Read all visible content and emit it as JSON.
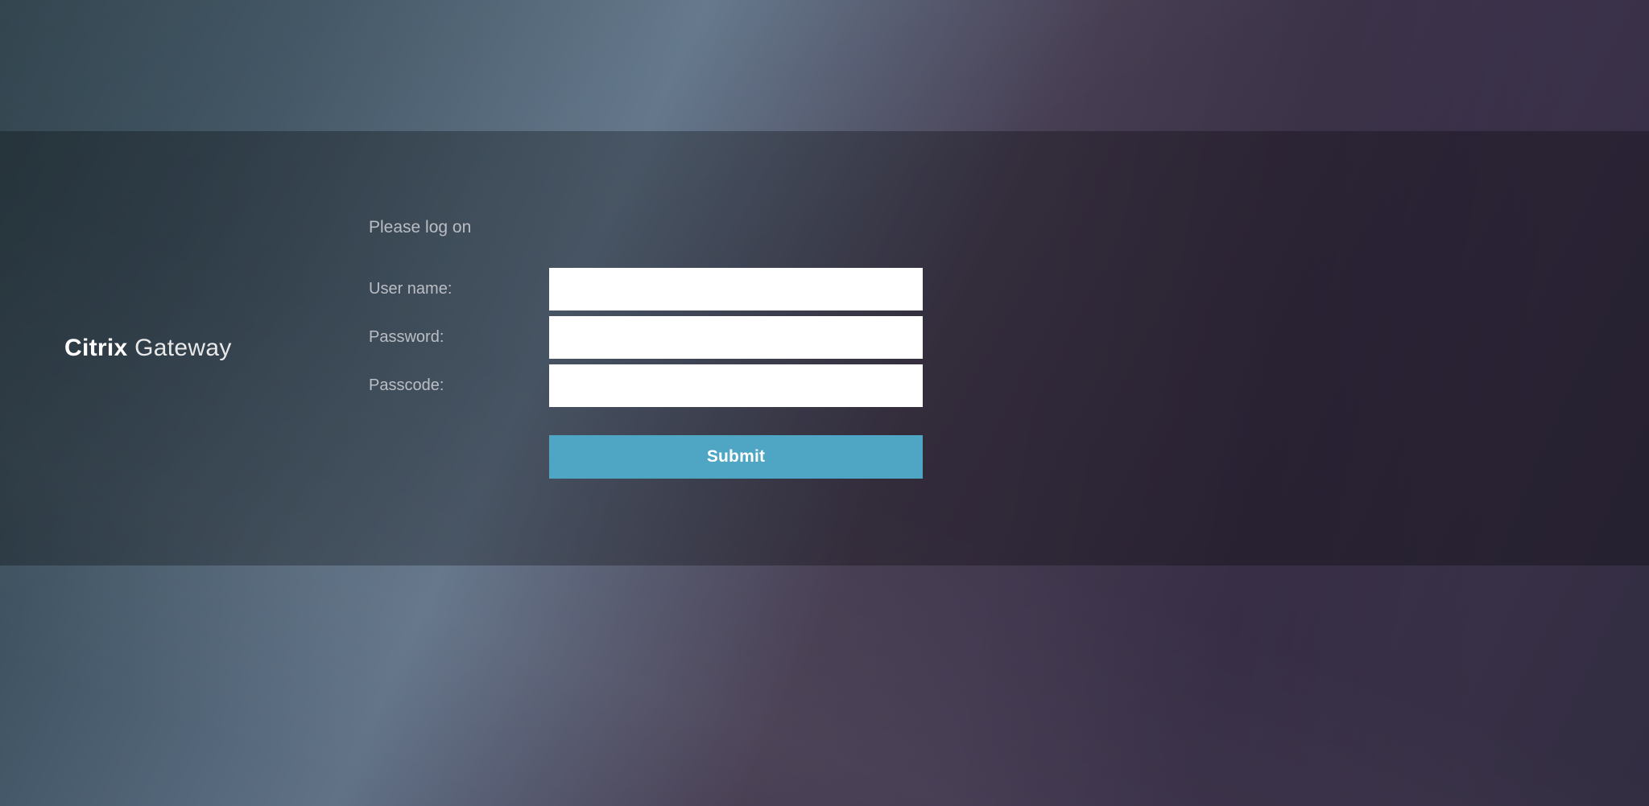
{
  "logo": {
    "brand": "Citrix",
    "product": "Gateway"
  },
  "form": {
    "instruction": "Please log on",
    "fields": {
      "username": {
        "label": "User name:",
        "value": ""
      },
      "password": {
        "label": "Password:",
        "value": ""
      },
      "passcode": {
        "label": "Passcode:",
        "value": ""
      }
    },
    "submit_label": "Submit"
  },
  "colors": {
    "submit_bg": "#4fa6c4",
    "panel_overlay": "rgba(0,0,0,0.28)"
  }
}
